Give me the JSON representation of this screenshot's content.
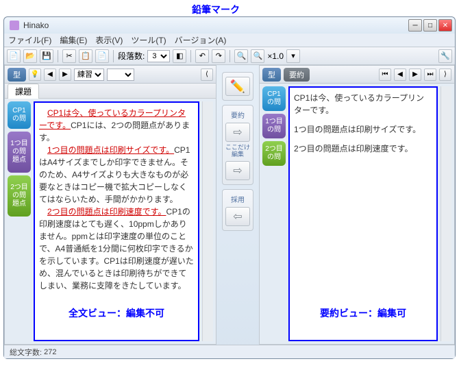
{
  "callout": {
    "label": "鉛筆マーク"
  },
  "window": {
    "title": "Hinako"
  },
  "menu": {
    "file": "ファイル(F)",
    "edit": "編集(E)",
    "view": "表示(V)",
    "tool": "ツール(T)",
    "version": "バージョン(A)"
  },
  "toolbar": {
    "paragraph_label": "段落数:",
    "paragraph_value": "3",
    "zoom": "×1.0"
  },
  "left": {
    "type_label": "型",
    "practice_label": "練習",
    "tabs": {
      "subject": "課題",
      "cp1": "CP1\nの問",
      "p1": "1つ目\nの問\n題点",
      "p2": "2つ目\nの問\n題点"
    },
    "text": {
      "s1u": "CP1は今、使っているカラープリンターです。",
      "s1": "CP1には、2つの問題点があります。",
      "s2u": "1つ目の問題点は印刷サイズです。",
      "s2": "CP1はA4サイズまでしか印字できません。そのため、A4サイズよりも大きなものが必要なときはコピー機で拡大コピーしなくてはならいため、手間がかかります。",
      "s3u": "2つ目の問題点は印刷速度です。",
      "s3": "CP1の印刷速度はとても遅く、10ppmしかありません。ppmとは印字速度の単位のことで、A4普通紙を1分間に何枚印字できるかを示しています。CP1は印刷速度が遅いため、混んでいるときは印刷待ちができてしまい、業務に支障をきたしています。"
    },
    "view_caption": "全文ビュー：編集不可"
  },
  "mid": {
    "pencil_name": "pencil-icon",
    "summary_label": "要約",
    "partial_label": "ここだけ\n編集",
    "adopt_label": "採用"
  },
  "right": {
    "type_label": "型",
    "summary_label": "要約",
    "tabs": {
      "cp1": "CP1\nの問",
      "p1": "1つ目\nの問",
      "p2": "2つ目\nの問"
    },
    "text": {
      "l1": "CP1は今、使っているカラープリンターです。",
      "l2": "1つ目の問題点は印刷サイズです。",
      "l3": "2つ目の問題点は印刷速度です。"
    },
    "view_caption": "要約ビュー：編集可"
  },
  "status": {
    "chars_label": "総文字数:",
    "chars_value": "272"
  }
}
